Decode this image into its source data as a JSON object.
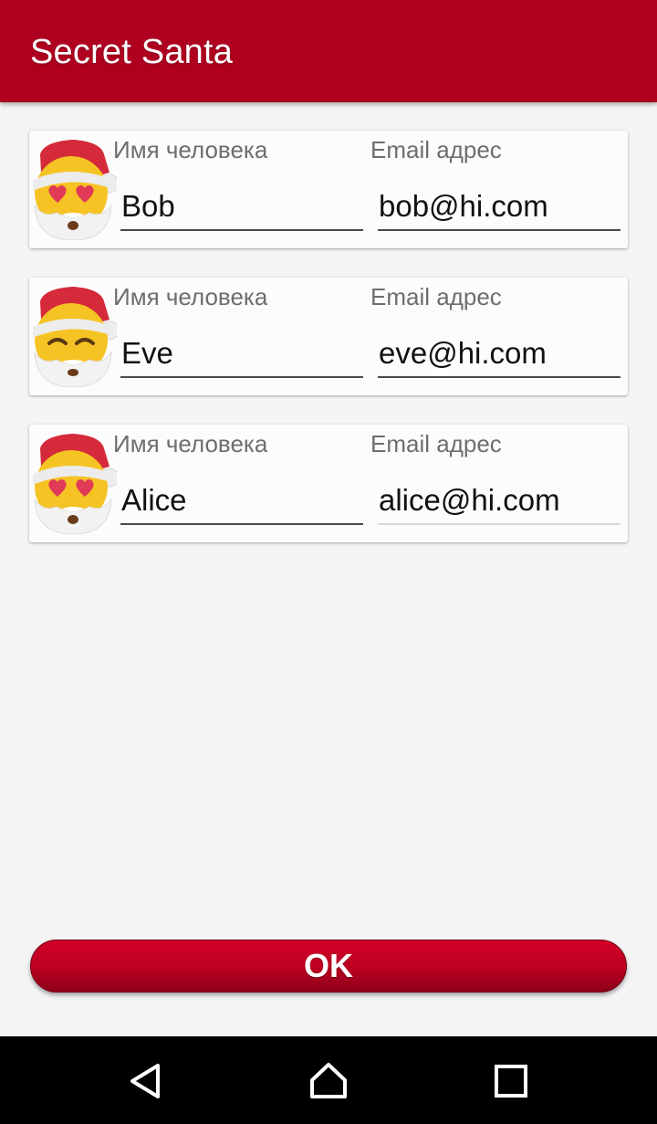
{
  "app": {
    "title": "Secret Santa"
  },
  "participants": [
    {
      "avatar": "santa-heart-eyes-icon",
      "name_label": "Имя человека",
      "name": "Bob",
      "email_label": "Email адрес",
      "email": "bob@hi.com"
    },
    {
      "avatar": "santa-smiling-icon",
      "name_label": "Имя человека",
      "name": "Eve",
      "email_label": "Email адрес",
      "email": "eve@hi.com"
    },
    {
      "avatar": "santa-heart-eyes-icon",
      "name_label": "Имя человека",
      "name": "Alice",
      "email_label": "Email адрес",
      "email": "alice@hi.com"
    }
  ],
  "ok_button": {
    "label": "OK"
  },
  "navigation": {
    "back": "back-icon",
    "home": "home-icon",
    "recents": "recents-icon"
  },
  "colors": {
    "primary": "#af0020",
    "button": "#c4001f",
    "background": "#f4f4f4",
    "navbar": "#000000"
  }
}
